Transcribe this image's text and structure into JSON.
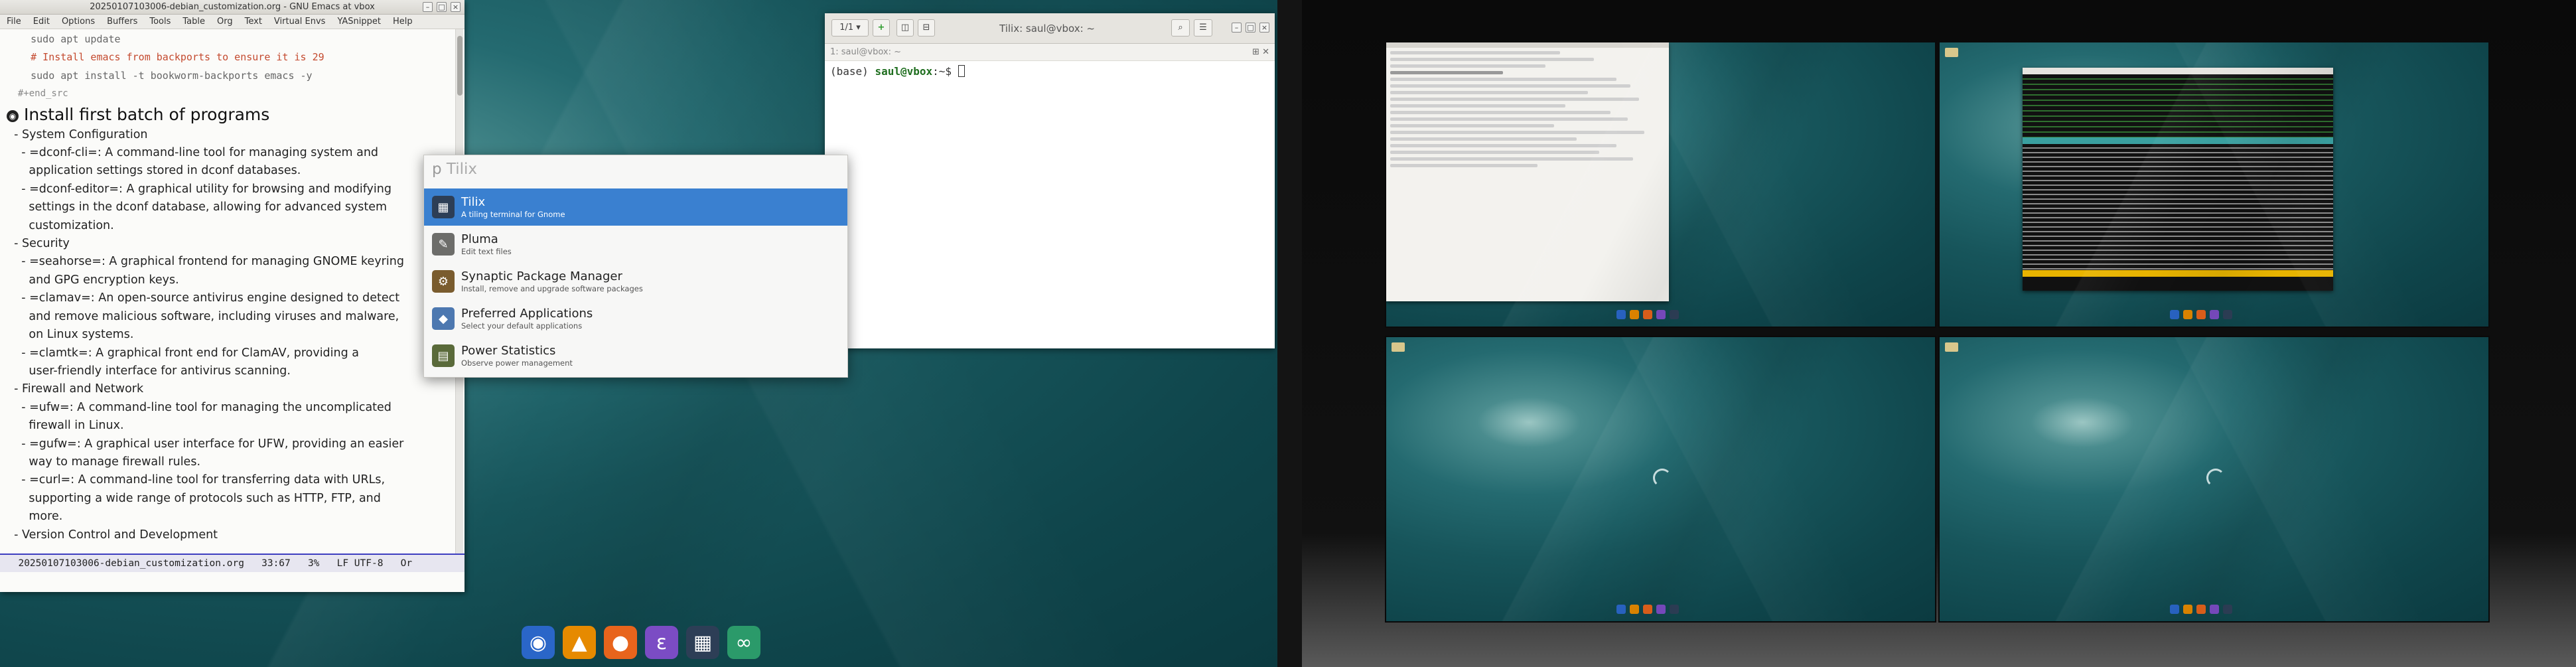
{
  "emacs": {
    "title": "20250107103006-debian_customization.org - GNU Emacs at vbox",
    "menu": [
      "File",
      "Edit",
      "Options",
      "Buffers",
      "Tools",
      "Table",
      "Org",
      "Text",
      "Virtual Envs",
      "YASnippet",
      "Help"
    ],
    "lines": [
      {
        "cls": "code",
        "text": "    sudo apt update"
      },
      {
        "cls": "cmt",
        "text": "    # Install emacs from backports to ensure it is 29"
      },
      {
        "cls": "code",
        "text": "    sudo apt install -t bookworm-backports emacs -y"
      },
      {
        "cls": "meta",
        "text": "  #+end_src"
      },
      {
        "cls": "h1",
        "text": "Install first batch of programs"
      },
      {
        "cls": "",
        "text": "  - System Configuration"
      },
      {
        "cls": "",
        "text": "    - =dconf-cli=: A command-line tool for managing system and"
      },
      {
        "cls": "",
        "text": "      application settings stored in dconf databases."
      },
      {
        "cls": "",
        "text": "    - =dconf-editor=: A graphical utility for browsing and modifying"
      },
      {
        "cls": "",
        "text": "      settings in the dconf database, allowing for advanced system"
      },
      {
        "cls": "",
        "text": "      customization."
      },
      {
        "cls": "",
        "text": "  - Security"
      },
      {
        "cls": "",
        "text": "    - =seahorse=: A graphical frontend for managing GNOME keyring"
      },
      {
        "cls": "",
        "text": "      and GPG encryption keys."
      },
      {
        "cls": "",
        "text": "    - =clamav=: An open-source antivirus engine designed to detect"
      },
      {
        "cls": "",
        "text": "      and remove malicious software, including viruses and malware,"
      },
      {
        "cls": "",
        "text": "      on Linux systems."
      },
      {
        "cls": "",
        "text": "    - =clamtk=: A graphical front end for ClamAV, providing a"
      },
      {
        "cls": "",
        "text": "      user-friendly interface for antivirus scanning."
      },
      {
        "cls": "",
        "text": "  - Firewall and Network"
      },
      {
        "cls": "",
        "text": "    - =ufw=: A command-line tool for managing the uncomplicated"
      },
      {
        "cls": "",
        "text": "      firewall in Linux."
      },
      {
        "cls": "",
        "text": "    - =gufw=: A graphical user interface for UFW, providing an easier"
      },
      {
        "cls": "",
        "text": "      way to manage firewall rules."
      },
      {
        "cls": "",
        "text": "    - =curl=: A command-line tool for transferring data with URLs,"
      },
      {
        "cls": "",
        "text": "      supporting a wide range of protocols such as HTTP, FTP, and"
      },
      {
        "cls": "",
        "text": "      more."
      },
      {
        "cls": "",
        "text": "  - Version Control and Development"
      }
    ],
    "modeline": "  20250107103006-debian_customization.org   33:67   3%   LF UTF-8   Or"
  },
  "tilix": {
    "tab": "1/1",
    "title": "Tilix: saul@vbox: ~",
    "subtitle": "1: saul@vbox: ~",
    "env": "(base) ",
    "user": "saul@vbox",
    "prompt": ":~$ "
  },
  "launcher": {
    "query_prefix": "p ",
    "query": "Tilix",
    "items": [
      {
        "name": "Tilix",
        "desc": "A tiling terminal for Gnome",
        "color": "#2d3e56",
        "glyph": "▦"
      },
      {
        "name": "Pluma",
        "desc": "Edit text files",
        "color": "#6d6d6a",
        "glyph": "✎"
      },
      {
        "name": "Synaptic Package Manager",
        "desc": "Install, remove and upgrade software packages",
        "color": "#7a5c2e",
        "glyph": "⚙"
      },
      {
        "name": "Preferred Applications",
        "desc": "Select your default applications",
        "color": "#4d78b0",
        "glyph": "◆"
      },
      {
        "name": "Power Statistics",
        "desc": "Observe power management",
        "color": "#5a6a3a",
        "glyph": "▤"
      }
    ]
  },
  "dock": [
    {
      "name": "debian-icon",
      "color": "#2a66c8",
      "glyph": "◉"
    },
    {
      "name": "vlc-icon",
      "color": "#e68a00",
      "glyph": "▲"
    },
    {
      "name": "firefox-icon",
      "color": "#e8641c",
      "glyph": "●"
    },
    {
      "name": "emacs-icon",
      "color": "#7b4cc4",
      "glyph": "ε"
    },
    {
      "name": "tilix-icon",
      "color": "#2d3e56",
      "glyph": "▦"
    },
    {
      "name": "anaconda-icon",
      "color": "#2b9a6a",
      "glyph": "∞"
    }
  ]
}
